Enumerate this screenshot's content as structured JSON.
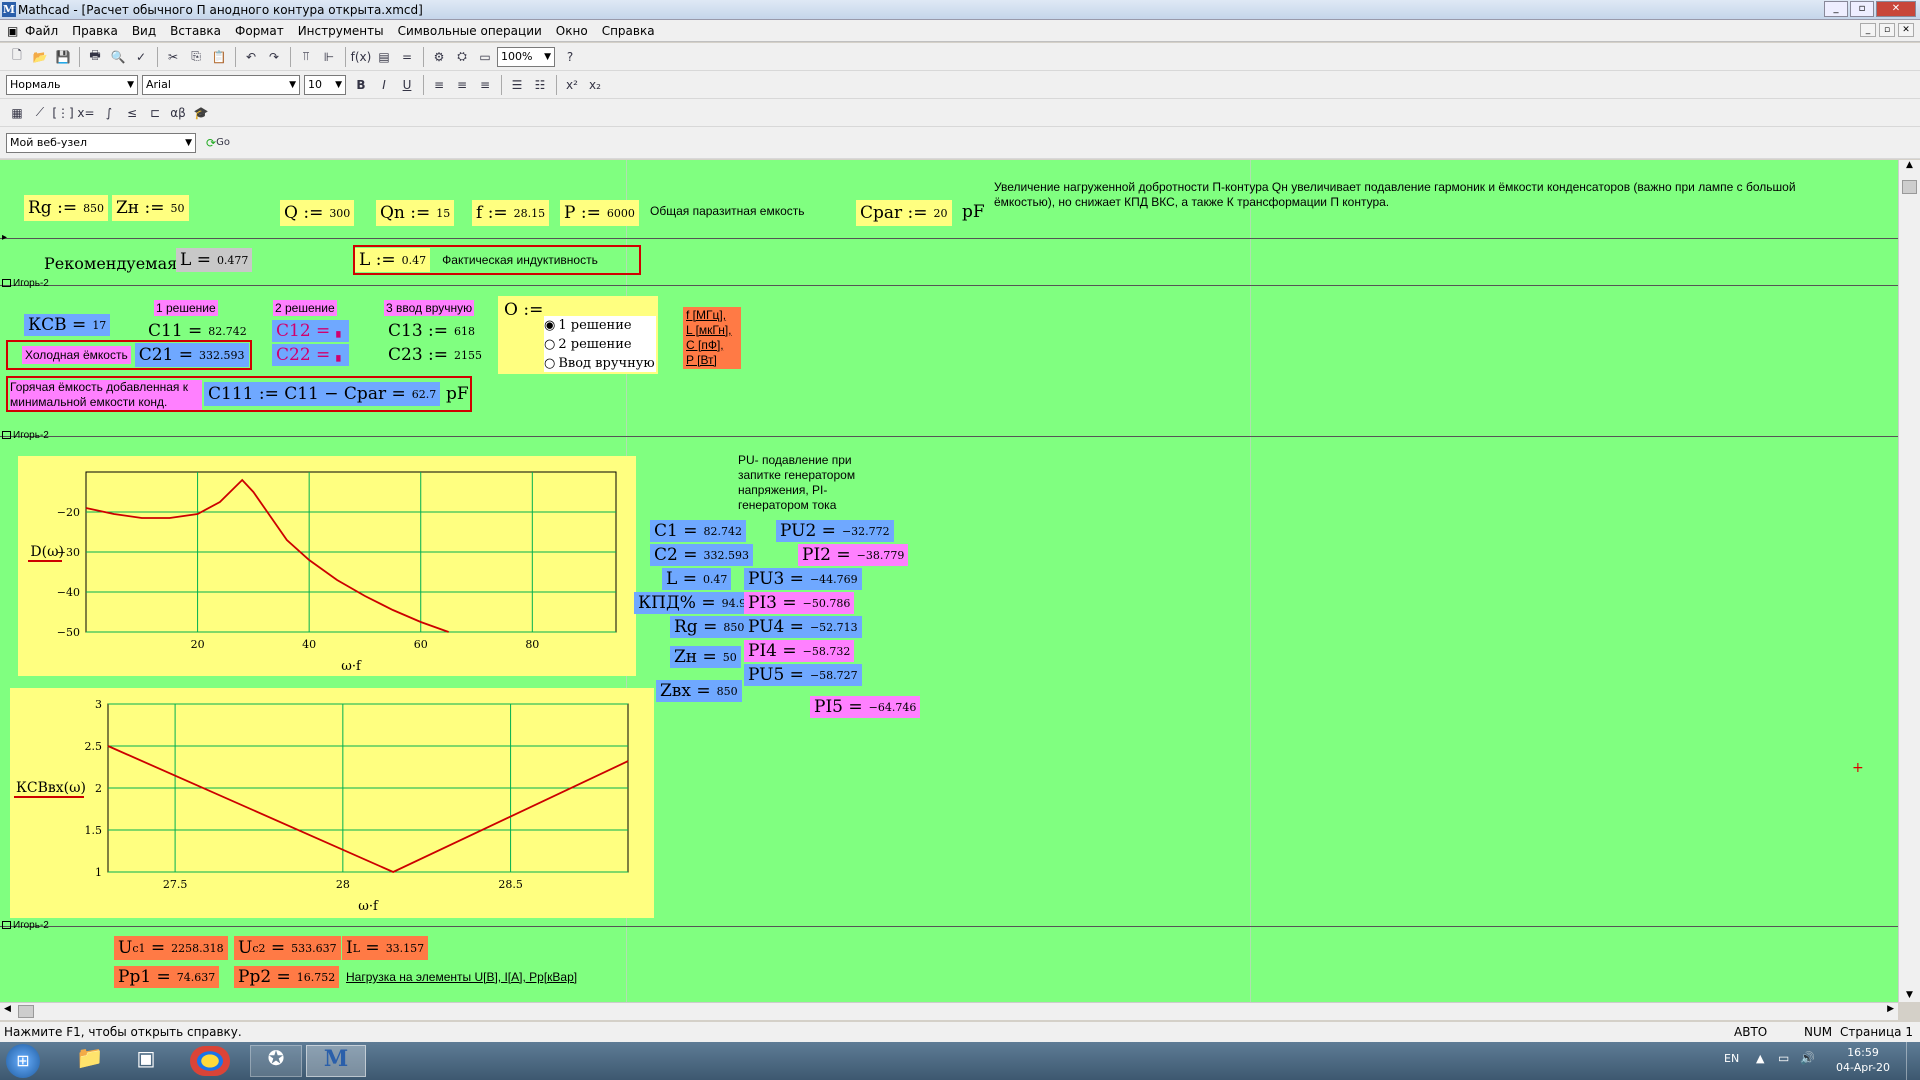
{
  "window": {
    "title": "Mathcad - [Расчет обычного П анодного контура открыта.xmcd]",
    "icon": "M"
  },
  "menu": [
    "Файл",
    "Правка",
    "Вид",
    "Вставка",
    "Формат",
    "Инструменты",
    "Символьные операции",
    "Окно",
    "Справка"
  ],
  "toolbar": {
    "zoom": "100%",
    "style": "Нормаль",
    "font": "Arial",
    "size": "10",
    "url": "Мой веб-узел",
    "go": "Go"
  },
  "row1": {
    "rg": "Rg :=",
    "rg_v": "850",
    "zn": "Zн :=",
    "zn_v": "50",
    "q": "Q :=",
    "q_v": "300",
    "qn": "Qn :=",
    "qn_v": "15",
    "f": "f :=",
    "f_v": "28.15",
    "pw": "P :=",
    "pw_v": "6000",
    "para": "Общая паразитная емкость",
    "cpar": "Cpar :=",
    "cpar_v": "20",
    "pF": "pF",
    "note": "Увеличение нагруженной добротности П-контура Qн увеличивает подавление гармоник и ёмкости конденсаторов (важно при лампе с большой ёмкостью), но снижает КПД ВКС, а также К трансформации П контура."
  },
  "row2": {
    "rec": "Рекомендуемая",
    "L": "L =",
    "L_v": "0.477",
    "Ls": "L :=",
    "Ls_v": "0.47",
    "fact": "Фактическая индуктивность"
  },
  "region": "Игорь-2",
  "sol": {
    "ksv": "КСВ =",
    "ksv_v": "17",
    "s1": "1 решение",
    "s2": "2 решение",
    "s3": "3 ввод вручную",
    "c11": "C11 =",
    "c11_v": "82.742",
    "c12": "C12 =",
    "c12_v": "▖",
    "c13": "C13 :=",
    "c13_v": "618",
    "cold": "Холодная ёмкость",
    "c21": "C21 =",
    "c21_v": "332.593",
    "c22": "C22 =",
    "c22_v": "▖",
    "c23": "C23 :=",
    "c23_v": "2155",
    "o": "O :=",
    "radio": [
      "1 решение",
      "2 решение",
      "Ввод вручную"
    ],
    "units": [
      "f [МГц],",
      "L [мкГн],",
      "C [пФ],",
      "P [Вт]"
    ],
    "hot": "Горячая ёмкость добавленная к минимальной емкости конд.",
    "c111": "C111 := C11 − Cpar =",
    "c111_v": "62.7",
    "pF": "pF"
  },
  "results": {
    "pu_note": "PU- подавление при запитке генератором напряжения, PI- генератором тока",
    "c1": "C1 =",
    "c1_v": "82.742",
    "c2": "C2 =",
    "c2_v": "332.593",
    "l": "L =",
    "l_v": "0.47",
    "kpd": "КПД% =",
    "kpd_v": "94.9",
    "rg": "Rg =",
    "rg_v": "850",
    "zn": "Zн =",
    "zn_v": "50",
    "zvx": "Zвх =",
    "zvx_v": "850",
    "pu2": "PU2 =",
    "pu2_v": "−32.772",
    "pi2": "PI2 =",
    "pi2_v": "−38.779",
    "pu3": "PU3 =",
    "pu3_v": "−44.769",
    "pi3": "PI3 =",
    "pi3_v": "−50.786",
    "pu4": "PU4 =",
    "pu4_v": "−52.713",
    "pi4": "PI4 =",
    "pi4_v": "−58.732",
    "pu5": "PU5 =",
    "pu5_v": "−58.727",
    "pi5": "PI5 =",
    "pi5_v": "−64.746"
  },
  "bottom": {
    "uc1": "U",
    "uc1_sub": "c1",
    "uc1_v": "2258.318",
    "uc2": "U",
    "uc2_sub": "c2",
    "uc2_v": "533.637",
    "il": "I",
    "il_sub": "L",
    "il_v": "33.157",
    "pp1": "Pp1 =",
    "pp1_v": "74.637",
    "pp2": "Pp2 =",
    "pp2_v": "16.752",
    "load": "Нагрузка на элементы U[В], I[А], Pр[кВар]"
  },
  "status": {
    "hint": "Нажмите F1, чтобы открыть справку.",
    "auto": "АВТО",
    "num": "NUM",
    "page": "Страница 1"
  },
  "tray": {
    "lang": "EN",
    "time": "16:59",
    "date": "04-Apr-20"
  },
  "chart_data": [
    {
      "type": "line",
      "ylabel": "D(ω)",
      "xlabel": "ω·f",
      "xlim": [
        0,
        95
      ],
      "ylim": [
        -50,
        -10
      ],
      "xticks": [
        20,
        40,
        60,
        80
      ],
      "yticks": [
        -20,
        -30,
        -40,
        -50
      ],
      "grid": true,
      "series": [
        {
          "color": "#cc0000",
          "x": [
            0,
            5,
            10,
            15,
            20,
            24,
            28,
            30,
            33,
            36,
            40,
            45,
            50,
            55,
            60,
            65
          ],
          "y": [
            -19,
            -20.5,
            -21.5,
            -21.5,
            -20.5,
            -17.5,
            -12,
            -15,
            -21,
            -27,
            -32,
            -37,
            -41,
            -44.5,
            -47.5,
            -50
          ]
        }
      ]
    },
    {
      "type": "line",
      "ylabel": "КСВвх(ω)",
      "xlabel": "ω·f",
      "xlim": [
        27.3,
        28.85
      ],
      "ylim": [
        1,
        3
      ],
      "xticks": [
        27.5,
        28,
        28.5
      ],
      "yticks": [
        3,
        2.5,
        2,
        1.5,
        1
      ],
      "grid": true,
      "series": [
        {
          "color": "#cc0000",
          "x": [
            27.3,
            28.15,
            28.85
          ],
          "y": [
            2.5,
            1,
            2.32
          ]
        }
      ]
    }
  ]
}
